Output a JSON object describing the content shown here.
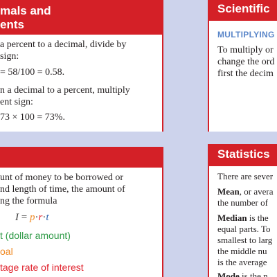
{
  "panel_decimals": {
    "title_line1": "mals and",
    "title_line2": "ents",
    "lines": [
      "a percent to a decimal, divide by",
      "sign:",
      "= 58/100 = 0.58.",
      "n a decimal to a percent, multiply",
      "ent sign:",
      "73 × 100 = 73%."
    ]
  },
  "panel_scientific": {
    "title": "Scientific",
    "subhead": "MULTIPLYING",
    "lines": [
      "To multiply or",
      "change the ord",
      "first the decim"
    ]
  },
  "panel_interest": {
    "lines": [
      "unt of money to be borrowed or",
      "nd length of time, the amount of",
      "ng the formula"
    ],
    "formula": {
      "lhs": "I",
      "eq": " = ",
      "p": "p",
      "dot1": "·",
      "r": "r",
      "dot2": "·",
      "t": "t"
    },
    "legend": [
      {
        "text": "t (dollar amount)",
        "color": "#2e9a46"
      },
      {
        "text": "oal",
        "color": "#f08a24"
      },
      {
        "text": "tage rate of interest",
        "color": "#e0202b"
      }
    ]
  },
  "panel_statistics": {
    "title": "Statistics",
    "intro": "There are sever",
    "mean_term": "Mean",
    "mean_rest": ", or avera",
    "mean_line2": "the number of",
    "median_term": "Median",
    "median_rest": " is the",
    "median_lines": [
      "equal parts. To",
      "smallest to larg",
      "the middle nu",
      "is the average"
    ],
    "mode_term": "Mode",
    "mode_rest": " is the n"
  },
  "colors": {
    "header_red": "#d42027",
    "background": "#cdd3ec",
    "principal_green": "#2e9a46",
    "orange": "#f08a24",
    "rate_red": "#e0202b",
    "time_blue": "#2d64b0",
    "subhead_blue": "#5a86c9"
  }
}
